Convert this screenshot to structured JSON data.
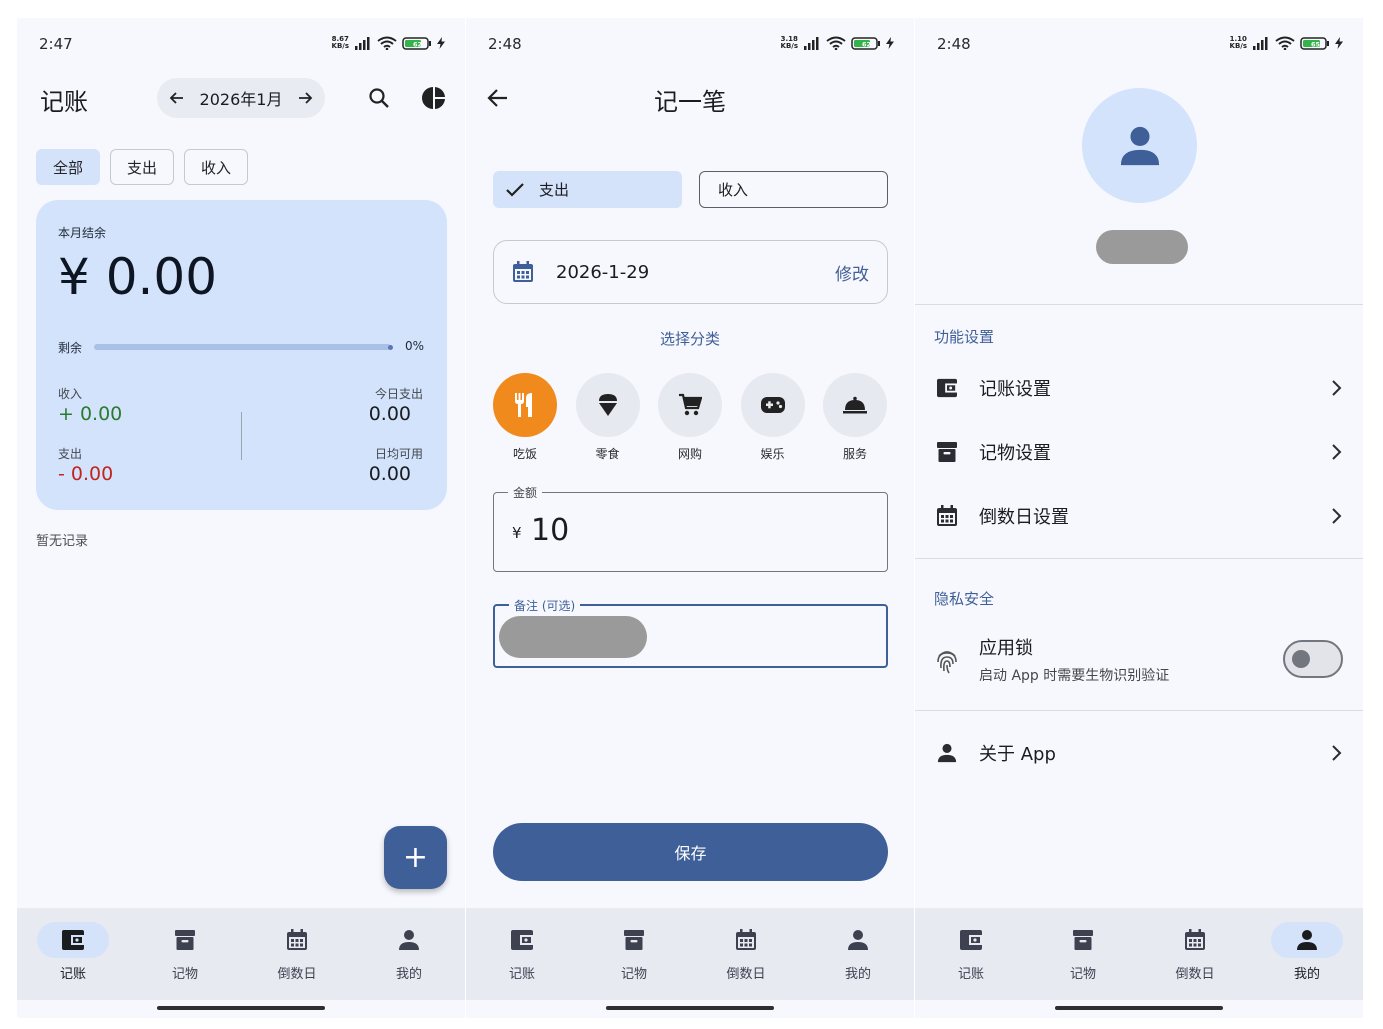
{
  "screens": {
    "ledger": {
      "status": {
        "time": "2:47",
        "net_top": "8.67",
        "net_bottom": "KB/s",
        "battery": "62"
      },
      "title": "记账",
      "month": "2026年1月",
      "filters": [
        "全部",
        "支出",
        "收入"
      ],
      "summary": {
        "label": "本月结余",
        "balance": "¥ 0.00",
        "remain_label": "剩余",
        "remain_percent": "0%",
        "remain_fraction": 0,
        "income_label": "收入",
        "income_value": "+ 0.00",
        "expense_label": "支出",
        "expense_value": "- 0.00",
        "today_label": "今日支出",
        "today_value": "0.00",
        "daily_label": "日均可用",
        "daily_value": "0.00"
      },
      "empty_text": "暂无记录",
      "fab": "+"
    },
    "record": {
      "status": {
        "time": "2:48",
        "net_top": "3.18",
        "net_bottom": "KB/s",
        "battery": "62"
      },
      "title": "记一笔",
      "type_expense": "支出",
      "type_income": "收入",
      "date": "2026-1-29",
      "edit": "修改",
      "category_title": "选择分类",
      "categories": [
        "吃饭",
        "零食",
        "网购",
        "娱乐",
        "服务"
      ],
      "amount_label": "金额",
      "currency": "¥",
      "amount": "10",
      "note_label": "备注 (可选)",
      "save": "保存"
    },
    "profile": {
      "status": {
        "time": "2:48",
        "net_top": "1.10",
        "net_bottom": "KB/s",
        "battery": "65"
      },
      "section_features": "功能设置",
      "items": [
        "记账设置",
        "记物设置",
        "倒数日设置"
      ],
      "section_privacy": "隐私安全",
      "lock_title": "应用锁",
      "lock_desc": "启动 App 时需要生物识别验证",
      "about": "关于 App"
    }
  },
  "nav": [
    "记账",
    "记物",
    "倒数日",
    "我的"
  ],
  "colors": {
    "primary": "#3f5f98",
    "container": "#d3e3fb",
    "orange": "#f08a1c",
    "green": "#2b7a2f",
    "red": "#c3241d"
  }
}
